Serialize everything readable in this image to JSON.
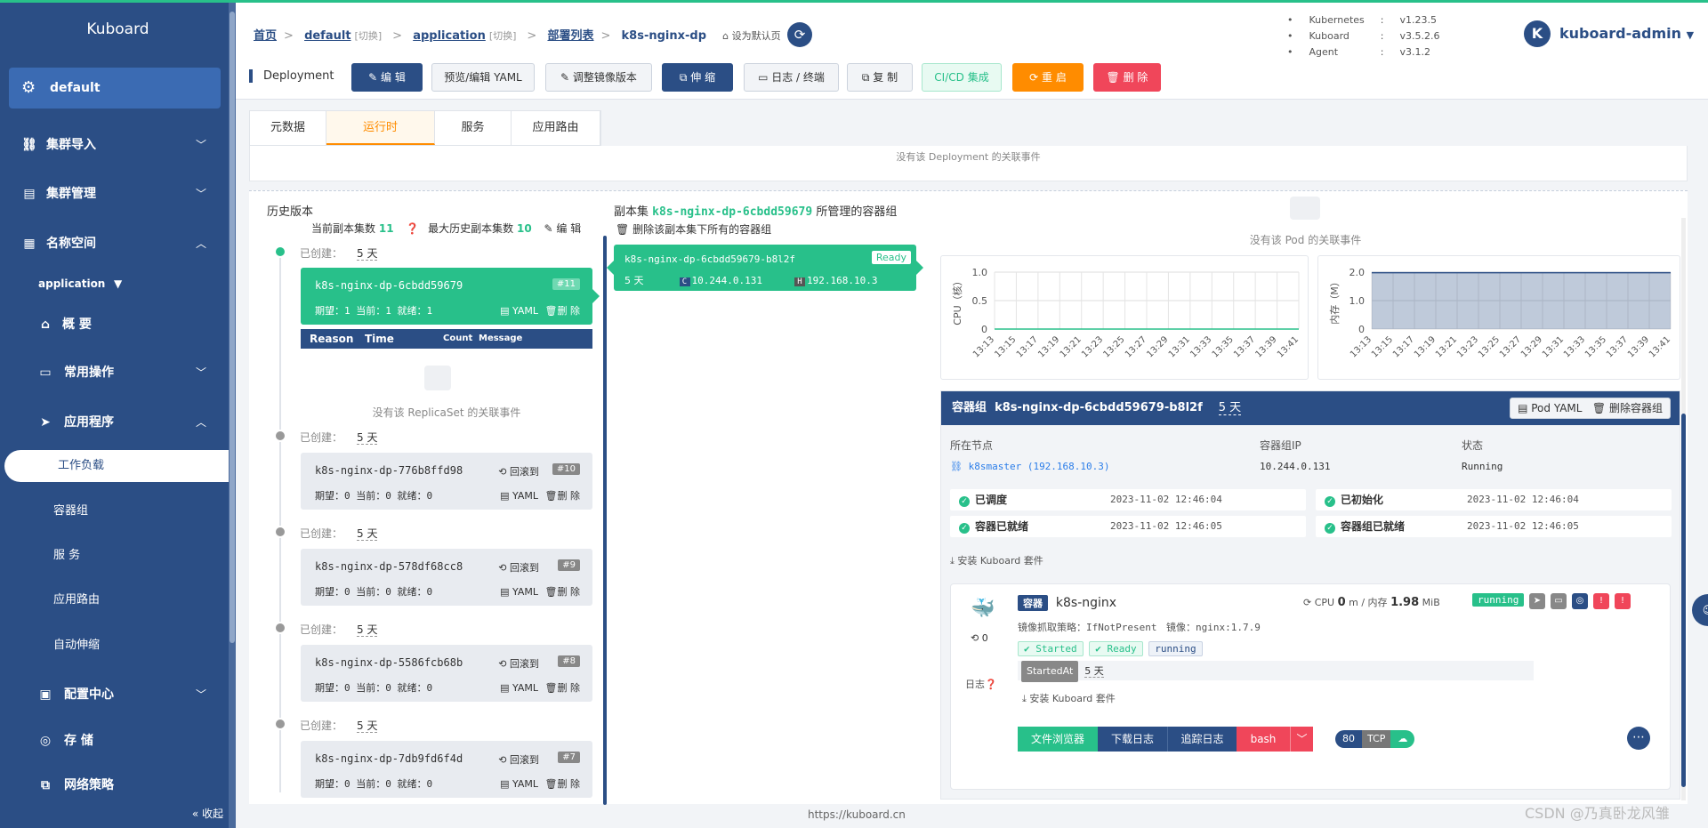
{
  "sidebar": {
    "brand": "Kuboard",
    "cluster": "default",
    "items": {
      "import": "集群导入",
      "manage": "集群管理",
      "namespace": "名称空间",
      "ops": "常用操作",
      "apps": "应用程序",
      "config": "配置中心",
      "storage": "存 储",
      "netpol": "网络策略"
    },
    "namespace_select": "application",
    "sub": {
      "workload": "工作负载",
      "pods": "容器组",
      "service": "服 务",
      "ingress": "应用路由",
      "hpa": "自动伸缩"
    },
    "collapse": "收起"
  },
  "header": {
    "breadcrumb": {
      "home": "首页",
      "cluster": "default",
      "cluster_switch": "[切换]",
      "ns": "application",
      "ns_switch": "[切换]",
      "list": "部署列表",
      "current": "k8s-nginx-dp",
      "set_default": "设为默认页"
    },
    "versions": [
      {
        "k": "Kubernetes",
        "v": "v1.23.5"
      },
      {
        "k": "Kuboard",
        "v": "v3.5.2.6"
      },
      {
        "k": "Agent",
        "v": "v3.1.2"
      }
    ],
    "user_initial": "K",
    "user": "kuboard-admin"
  },
  "toolbar": {
    "title": "Deployment",
    "edit": "编 辑",
    "yaml": "预览/编辑 YAML",
    "image": "调整镜像版本",
    "scale": "伸 缩",
    "logs": "日志 / 终端",
    "copy": "复 制",
    "cicd": "CI/CD 集成",
    "restart": "重 启",
    "delete": "删 除"
  },
  "tabs": {
    "meta": "元数据",
    "runtime": "运行时",
    "svc": "服务",
    "route": "应用路由"
  },
  "events_top": "没有该 Deployment 的关联事件",
  "history": {
    "title": "历史版本",
    "current_label": "当前副本集数",
    "current_val": "11",
    "max_label": "最大历史副本集数",
    "max_val": "10",
    "edit": "编 辑",
    "created_label": "已创建：",
    "age": "5 天",
    "items": [
      {
        "name": "k8s-nginx-dp-6cbdd59679",
        "rev": "#11",
        "stat": "期望：1 当前：1 就绪：1"
      },
      {
        "name": "k8s-nginx-dp-776b8ffd98",
        "rev": "#10",
        "stat": "期望：0 当前：0 就绪：0"
      },
      {
        "name": "k8s-nginx-dp-578df68cc8",
        "rev": "#9",
        "stat": "期望：0 当前：0 就绪：0"
      },
      {
        "name": "k8s-nginx-dp-5586fcb68b",
        "rev": "#8",
        "stat": "期望：0 当前：0 就绪：0"
      },
      {
        "name": "k8s-nginx-dp-7db9fd6f4d",
        "rev": "#7",
        "stat": "期望：0 当前：0 就绪：0"
      }
    ],
    "rollback": "回滚到",
    "yaml": "YAML",
    "del": "删 除",
    "ev_cols": {
      "reason": "Reason",
      "time": "Time",
      "count": "Count",
      "message": "Message"
    },
    "no_rs_event": "没有该 ReplicaSet 的关联事件"
  },
  "replicaset": {
    "prefix": "副本集",
    "name": "k8s-nginx-dp-6cbdd59679",
    "suffix": "所管理的容器组",
    "delete_all": "删除该副本集下所有的容器组"
  },
  "pod_card": {
    "name": "k8s-nginx-dp-6cbdd59679-b8l2f",
    "status": "Ready",
    "age": "5 天",
    "c": "C",
    "ip": "10.244.0.131",
    "h": "H",
    "host_ip": "192.168.10.3"
  },
  "no_pod_event": "没有该 Pod 的关联事件",
  "chart_data": [
    {
      "type": "line",
      "ylabel": "CPU（核）",
      "x": [
        "13:13",
        "13:15",
        "13:17",
        "13:19",
        "13:21",
        "13:23",
        "13:25",
        "13:27",
        "13:29",
        "13:31",
        "13:33",
        "13:35",
        "13:37",
        "13:39",
        "13:41"
      ],
      "y_ticks": [
        "1.0",
        "0.5",
        "0"
      ],
      "ylim": [
        0,
        1
      ],
      "series": [
        {
          "values": [
            0,
            0,
            0,
            0,
            0,
            0,
            0,
            0,
            0,
            0,
            0,
            0,
            0,
            0,
            0
          ]
        }
      ],
      "color": "#28c08a",
      "grid": true
    },
    {
      "type": "area",
      "ylabel": "内存（M）",
      "x": [
        "13:13",
        "13:15",
        "13:17",
        "13:19",
        "13:21",
        "13:23",
        "13:25",
        "13:27",
        "13:29",
        "13:31",
        "13:33",
        "13:35",
        "13:37",
        "13:39",
        "13:41"
      ],
      "y_ticks": [
        "2.0",
        "1.0",
        "0"
      ],
      "ylim": [
        0,
        2
      ],
      "series": [
        {
          "values": [
            1.98,
            1.98,
            1.98,
            1.98,
            1.98,
            1.98,
            1.98,
            1.98,
            1.98,
            1.98,
            1.98,
            1.98,
            1.98,
            1.98,
            1.98
          ]
        }
      ],
      "color": "#2b4e85",
      "grid": true
    }
  ],
  "pod_detail": {
    "title": "容器组",
    "name": "k8s-nginx-dp-6cbdd59679-b8l2f",
    "age": "5 天",
    "pod_yaml": "Pod YAML",
    "delete": "删除容器组",
    "node_label": "所在节点",
    "node": "k8smaster (192.168.10.3)",
    "ip_label": "容器组IP",
    "ip": "10.244.0.131",
    "status_label": "状态",
    "status": "Running",
    "conditions": [
      {
        "name": "已调度",
        "time": "2023-11-02 12:46:04"
      },
      {
        "name": "已初始化",
        "time": "2023-11-02 12:46:04"
      },
      {
        "name": "容器已就绪",
        "time": "2023-11-02 12:46:05"
      },
      {
        "name": "容器组已就绪",
        "time": "2023-11-02 12:46:05"
      }
    ],
    "install": "安装 Kuboard 套件"
  },
  "container": {
    "tag": "容器",
    "name": "k8s-nginx",
    "restarts": "0",
    "cpu_label": "CPU",
    "cpu": "0",
    "cpu_unit": "m / 内存",
    "mem": "1.98",
    "mem_unit": "MiB",
    "state": "running",
    "pull_label": "镜像抓取策略：",
    "pull": "IfNotPresent",
    "image_label": "镜像：",
    "image": "nginx:1.7.9",
    "chips": [
      "Started",
      "Ready",
      "running"
    ],
    "started_at": "StartedAt",
    "started_val": "5 天",
    "log_label": "日志",
    "install": "安装 Kuboard 套件",
    "buttons": {
      "files": "文件浏览器",
      "download": "下载日志",
      "tail": "追踪日志",
      "bash": "bash"
    },
    "port": "80",
    "proto": "TCP"
  },
  "footer": "https://kuboard.cn",
  "watermark": "CSDN @乃真卧龙风雏"
}
